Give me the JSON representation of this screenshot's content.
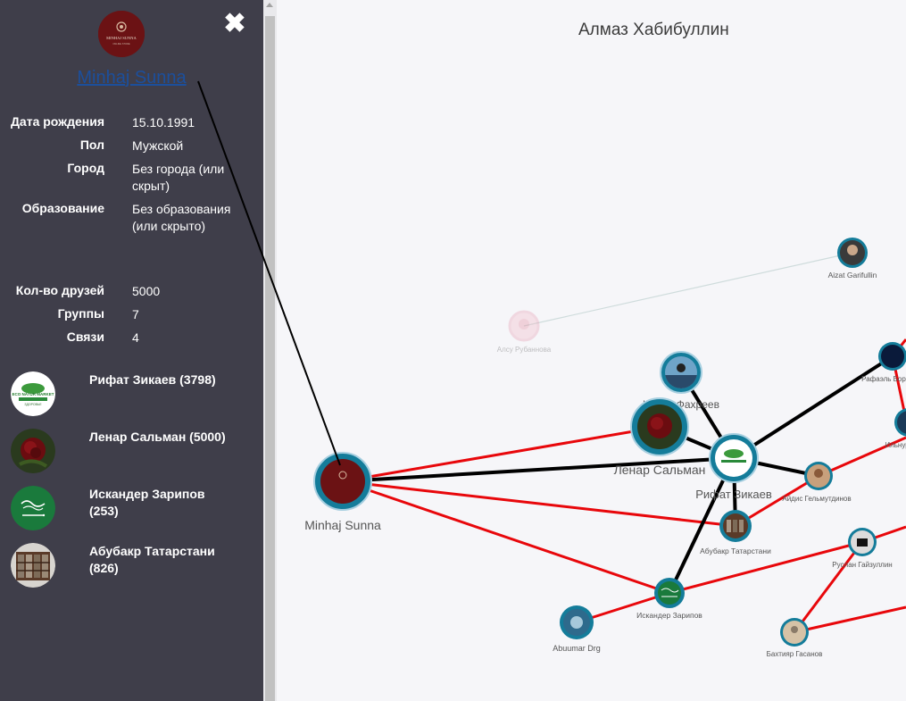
{
  "sidebar": {
    "profile_name": "Minhaj Sunna",
    "avatar_text": "MINHAJ SUNNA",
    "avatar_sub": "ONLINE STORE",
    "close_icon": "close-icon",
    "info": [
      {
        "label": "Дата рождения",
        "value": "15.10.1991"
      },
      {
        "label": "Пол",
        "value": "Мужской"
      },
      {
        "label": "Город",
        "value": "Без города (или скрыт)"
      },
      {
        "label": "Образование",
        "value": "Без образования (или скрыто)"
      },
      {
        "label": "Кол-во друзей",
        "value": "5000"
      },
      {
        "label": "Группы",
        "value": "7"
      },
      {
        "label": "Связи",
        "value": "4"
      }
    ],
    "friends": [
      {
        "name": "Рифат Зикаев (3798)",
        "avatar_text": "ECO NATUR MARKET",
        "avatar_sub": "ЗДОРОВЬЕ"
      },
      {
        "name": "Ленар Сальман (5000)"
      },
      {
        "name": "Искандер Зарипов (253)"
      },
      {
        "name": "Абубакр Татарстани (826)"
      }
    ]
  },
  "graph": {
    "title": "Алмаз Хабибуллин",
    "nodes": {
      "minhaj": "Minhaj Sunna",
      "lenar": "Ленар Сальман",
      "rifat": "Рифат Зикаев",
      "ilyas": "Ильяс Фахреев",
      "almaz_g": "Айдис Гельмутдинов",
      "abubakr": "Абубакр Татарстани",
      "iskander": "Искандер Зарипов",
      "abuumar": "Abuumar Drg",
      "rustam": "Руслан Гайзуллин",
      "bakhtiyar": "Бахтияр Гасанов",
      "alsu": "Алсу Рубаннова",
      "aizat": "Aizat Garifullin",
      "rafael": "Рафаэль Бор",
      "ilnur": "Ильнур"
    }
  },
  "colors": {
    "sidebar_bg": "#3f3e4a",
    "link": "#1c4f9c",
    "edge_red": "#e8070b",
    "edge_black": "#000000",
    "node_ring": "#147c9a"
  }
}
